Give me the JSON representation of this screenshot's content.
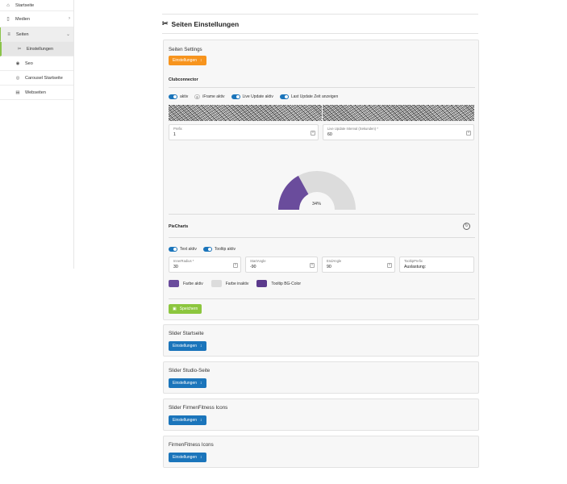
{
  "sidebar": {
    "items": [
      {
        "label": "Startseite",
        "icon": "home-icon"
      },
      {
        "label": "Medien",
        "icon": "media-icon"
      },
      {
        "label": "Seiten",
        "icon": "list-icon"
      },
      {
        "label": "Einstellungen",
        "icon": "tools-icon"
      },
      {
        "label": "Seo",
        "icon": "eye-icon"
      },
      {
        "label": "Carousel Startseite",
        "icon": "carousel-icon"
      },
      {
        "label": "Webseiten",
        "icon": "web-icon"
      }
    ]
  },
  "page": {
    "title": "Seiten Einstellungen"
  },
  "settings_card": {
    "title": "Seiten Settings",
    "button": "Einstellungen",
    "clubconnector": {
      "label": "Clubconnector",
      "toggles": [
        {
          "label": "aktiv",
          "on": true
        },
        {
          "label": "iFrame aktiv",
          "on": false
        },
        {
          "label": "Live Update aktiv",
          "on": true
        },
        {
          "label": "Last Update Zeit anzeigen",
          "on": true
        }
      ],
      "prefix": {
        "label": "Prefix",
        "value": "1"
      },
      "interval": {
        "label": "Live Update Interval (Sekunden) *",
        "value": "60"
      }
    },
    "gauge": {
      "percent_label": "34%",
      "value": 34
    },
    "piecharts": {
      "label": "PieCharts",
      "toggles": [
        {
          "label": "Text aktiv",
          "on": true
        },
        {
          "label": "Tooltip aktiv",
          "on": true
        }
      ],
      "fields": [
        {
          "label": "InnerRadius *",
          "value": "30"
        },
        {
          "label": "StartAngle",
          "value": "-90"
        },
        {
          "label": "EndAngle",
          "value": "90"
        },
        {
          "label": "TooltipPrefix",
          "value": "Auslastung:"
        }
      ],
      "colors": [
        {
          "label": "Farbe aktiv",
          "color": "#6a4c9c"
        },
        {
          "label": "Farbe inaktiv",
          "color": "#dcdcdc"
        },
        {
          "label": "Tooltip BG-Color",
          "color": "#5b3a8c"
        }
      ]
    },
    "save_button": "Speichern"
  },
  "cards": [
    {
      "title": "Slider Startseite",
      "button": "Einstellungen"
    },
    {
      "title": "Slider Studio-Seite",
      "button": "Einstellungen"
    },
    {
      "title": "Slider FirmenFitness Icons",
      "button": "Einstellungen"
    },
    {
      "title": "FirmenFitness Icons",
      "button": "Einstellungen"
    }
  ]
}
